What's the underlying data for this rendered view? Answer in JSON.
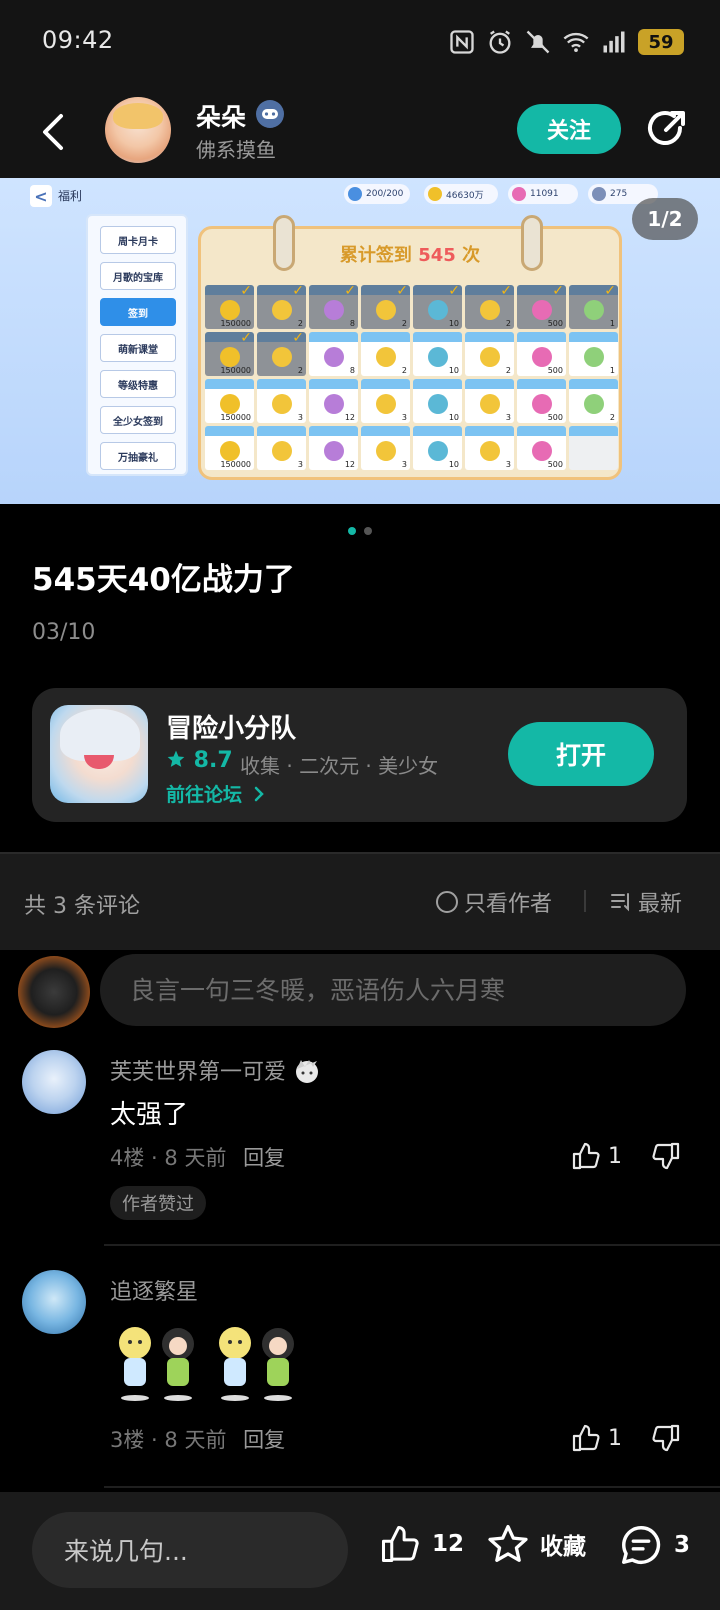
{
  "status_bar": {
    "time": "09:42",
    "battery": "59"
  },
  "header": {
    "author_name": "朵朵",
    "author_subtitle": "佛系摸鱼",
    "follow_label": "关注"
  },
  "banner": {
    "page_counter": "1/2",
    "top_bar": {
      "back_label": "<",
      "section": "福利",
      "stamina": "200/200",
      "gold": "46630万",
      "gems": "11091",
      "tickets": "275"
    },
    "menu": [
      "周卡月卡",
      "月歌的宝库",
      "签到",
      "萌新课堂",
      "等级特惠",
      "全少女签到",
      "万抽豪礼"
    ],
    "calendar_title_prefix": "累计签到",
    "calendar_count": "545",
    "calendar_title_suffix": "次",
    "rows": [
      [
        "150000",
        "2",
        "8",
        "2",
        "10",
        "2",
        "500",
        "1"
      ],
      [
        "150000",
        "2",
        "8",
        "2",
        "10",
        "2",
        "500",
        "1"
      ],
      [
        "150000",
        "3",
        "12",
        "3",
        "10",
        "3",
        "500",
        "2"
      ],
      [
        "150000",
        "3",
        "12",
        "3",
        "10",
        "3",
        "500",
        ""
      ]
    ]
  },
  "post": {
    "title": "545天40亿战力了",
    "date": "03/10"
  },
  "game": {
    "name": "冒险小分队",
    "rating": "8.7",
    "tags": "收集 · 二次元 · 美少女",
    "forum_link": "前往论坛",
    "open_label": "打开"
  },
  "comments_header": {
    "count_label": "共 3 条评论",
    "only_author": "只看作者",
    "sort": "最新"
  },
  "comment_input": {
    "placeholder": "良言一句三冬暖，恶语伤人六月寒"
  },
  "comments": [
    {
      "name": "芙芙世界第一可爱",
      "text": "太强了",
      "floor": "4楼",
      "time": "8 天前",
      "reply": "回复",
      "likes": "1",
      "badge": "作者赞过"
    },
    {
      "name": "追逐繁星",
      "text": "",
      "floor": "3楼",
      "time": "8 天前",
      "reply": "回复",
      "likes": "1"
    }
  ],
  "bottom_bar": {
    "input_placeholder": "来说几句...",
    "likes": "12",
    "collect": "收藏",
    "comments": "3"
  },
  "colors": {
    "accent": "#14b8a6",
    "background": "#000000",
    "card": "#242424"
  }
}
